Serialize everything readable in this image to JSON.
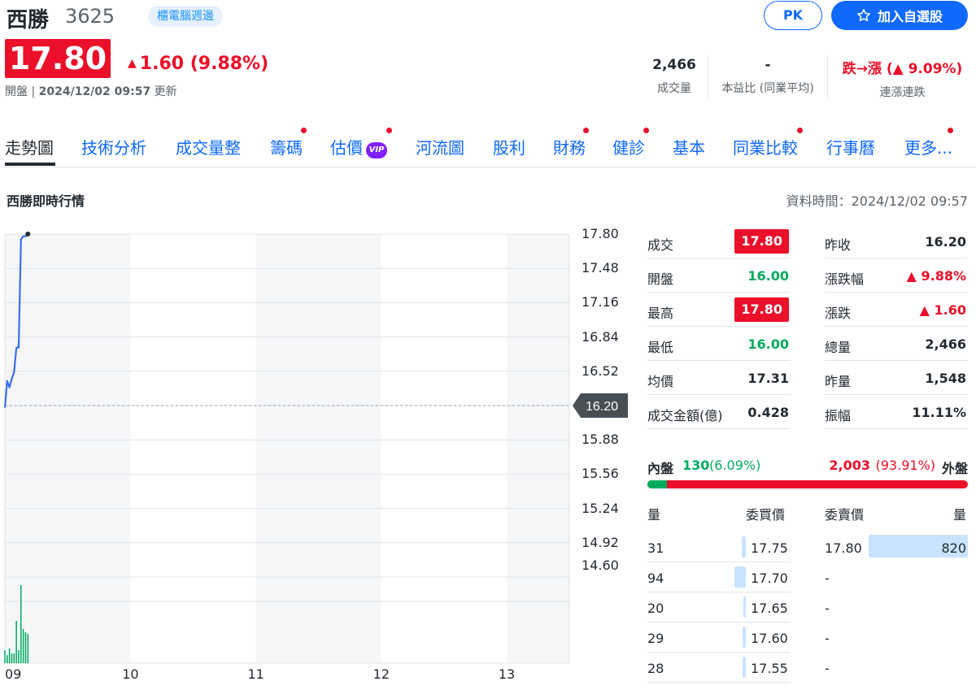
{
  "header": {
    "name": "西勝",
    "code": "3625",
    "sector": "櫃電腦週邊",
    "pk_label": "PK",
    "watch_label": "加入自選股",
    "price": "17.80",
    "change": "1.60 (9.88%)",
    "status_prefix": "開盤",
    "status_time": "2024/12/02 09:57",
    "status_suffix": "更新",
    "metrics": [
      {
        "value": "2,466",
        "label": "成交量"
      },
      {
        "value": "-",
        "label": "本益比 (同業平均)"
      },
      {
        "value": "跌→漲 (▲ 9.09%)",
        "label": "連漲連跌"
      }
    ]
  },
  "tabs": [
    "走勢圖",
    "技術分析",
    "成交量整",
    "籌碼",
    "估價",
    "河流圖",
    "股利",
    "財務",
    "健診",
    "基本",
    "同業比較",
    "行事曆",
    "更多..."
  ],
  "vip_label": "VIP",
  "section_title": "西勝即時行情",
  "data_time": "資料時間：2024/12/02 09:57",
  "chart_data": {
    "type": "line",
    "x_ticks": [
      "09",
      "10",
      "11",
      "12",
      "13"
    ],
    "y_ticks": [
      "17.80",
      "17.48",
      "17.16",
      "16.84",
      "16.52",
      "16.20",
      "15.88",
      "15.56",
      "15.24",
      "14.92",
      "14.60"
    ],
    "ylim": [
      14.6,
      17.8
    ],
    "reference_price": "16.20",
    "price_series": [
      {
        "t": 0,
        "v": 16.18
      },
      {
        "t": 11,
        "v": 16.43
      },
      {
        "t": 22,
        "v": 16.37
      },
      {
        "t": 33,
        "v": 16.45
      },
      {
        "t": 44,
        "v": 16.51
      },
      {
        "t": 55,
        "v": 16.74
      },
      {
        "t": 66,
        "v": 16.74
      },
      {
        "t": 77,
        "v": 17.75
      },
      {
        "t": 88,
        "v": 17.78
      },
      {
        "t": 99,
        "v": 17.78
      },
      {
        "t": 110,
        "v": 17.8
      }
    ],
    "volume_series": [
      {
        "t": 0,
        "v": 8
      },
      {
        "t": 11,
        "v": 5
      },
      {
        "t": 22,
        "v": 9
      },
      {
        "t": 33,
        "v": 6
      },
      {
        "t": 44,
        "v": 6
      },
      {
        "t": 55,
        "v": 26
      },
      {
        "t": 66,
        "v": 8
      },
      {
        "t": 77,
        "v": 48
      },
      {
        "t": 88,
        "v": 21
      },
      {
        "t": 99,
        "v": 19
      },
      {
        "t": 110,
        "v": 18
      }
    ]
  },
  "quote_left": [
    {
      "label": "成交",
      "value": "17.80",
      "style": "box"
    },
    {
      "label": "開盤",
      "value": "16.00",
      "style": "green"
    },
    {
      "label": "最高",
      "value": "17.80",
      "style": "box"
    },
    {
      "label": "最低",
      "value": "16.00",
      "style": "green"
    },
    {
      "label": "均價",
      "value": "17.31",
      "style": ""
    },
    {
      "label": "成交金額(億)",
      "value": "0.428",
      "style": ""
    }
  ],
  "quote_right": [
    {
      "label": "昨收",
      "value": "16.20",
      "style": ""
    },
    {
      "label": "漲跌幅",
      "value": "▲ 9.88%",
      "style": "red"
    },
    {
      "label": "漲跌",
      "value": "▲ 1.60",
      "style": "red"
    },
    {
      "label": "總量",
      "value": "2,466",
      "style": ""
    },
    {
      "label": "昨量",
      "value": "1,548",
      "style": ""
    },
    {
      "label": "振幅",
      "value": "11.11%",
      "style": ""
    }
  ],
  "inout": {
    "inner_label": "內盤",
    "inner_value": "130",
    "inner_pct": "(6.09%)",
    "outer_value": "2,003",
    "outer_pct": "(93.91%)",
    "outer_label": "外盤",
    "inner_fraction": 0.0609
  },
  "orderbook": {
    "headers": [
      "量",
      "委買價",
      "委賣價",
      "量"
    ],
    "rows": [
      {
        "bid_qty": "31",
        "bid": "17.75",
        "ask": "17.80",
        "ask_qty": "820",
        "bid_frac": 0.33,
        "ask_frac": 1.0
      },
      {
        "bid_qty": "94",
        "bid": "17.70",
        "ask": "-",
        "ask_qty": "",
        "bid_frac": 1.0,
        "ask_frac": 0
      },
      {
        "bid_qty": "20",
        "bid": "17.65",
        "ask": "-",
        "ask_qty": "",
        "bid_frac": 0.21,
        "ask_frac": 0
      },
      {
        "bid_qty": "29",
        "bid": "17.60",
        "ask": "-",
        "ask_qty": "",
        "bid_frac": 0.31,
        "ask_frac": 0
      },
      {
        "bid_qty": "28",
        "bid": "17.55",
        "ask": "-",
        "ask_qty": "",
        "bid_frac": 0.3,
        "ask_frac": 0
      }
    ]
  },
  "colors": {
    "up": "#eb0f29",
    "down": "#00ab5e",
    "accent": "#0f69ff",
    "line": "#3a6ff0"
  }
}
